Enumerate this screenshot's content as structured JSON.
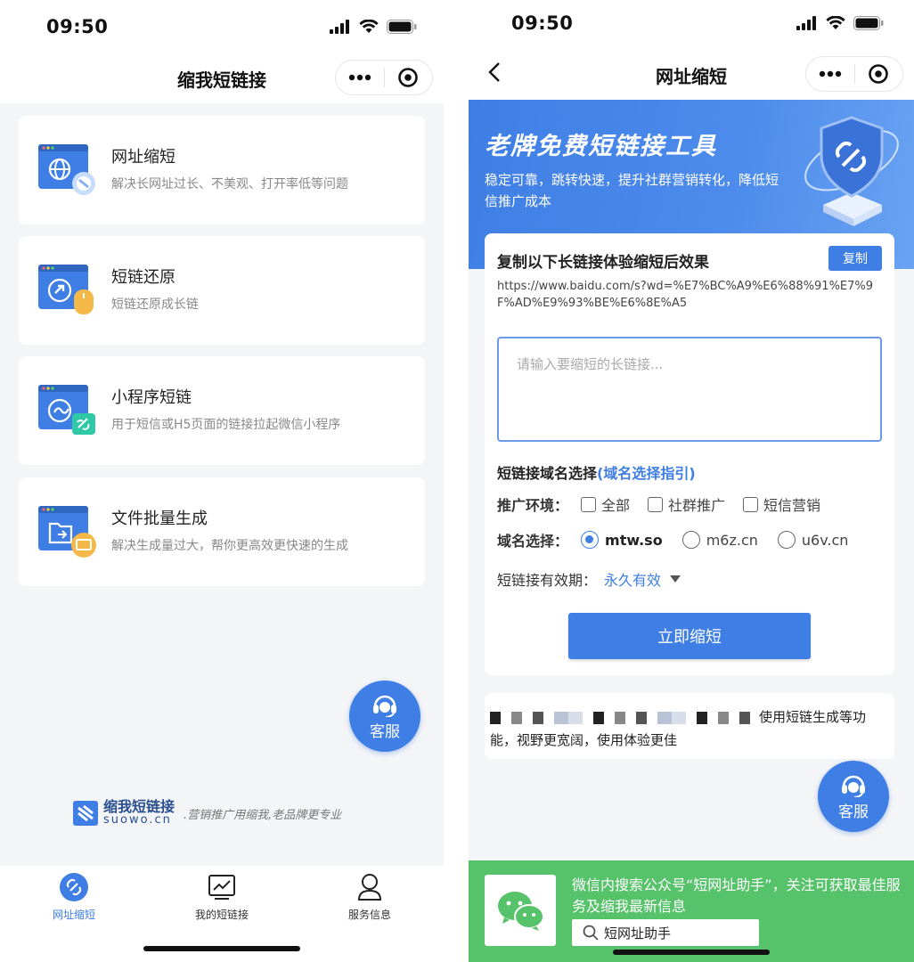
{
  "left": {
    "status_time": "09:50",
    "nav_title": "缩我短链接",
    "features": [
      {
        "title": "网址缩短",
        "desc": "解决长网址过长、不美观、打开率低等问题"
      },
      {
        "title": "短链还原",
        "desc": "短链还原成长链"
      },
      {
        "title": "小程序短链",
        "desc": "用于短信或H5页面的链接拉起微信小程序"
      },
      {
        "title": "文件批量生成",
        "desc": "解决生成量过大，帮你更高效更快速的生成"
      }
    ],
    "service_label": "客服",
    "brand_name": "缩我短链接",
    "brand_domain": "suowo.cn",
    "brand_slogan": ".营销推广用缩我,老品牌更专业",
    "tabs": [
      {
        "label": "网址缩短",
        "icon": "link-icon"
      },
      {
        "label": "我的短链接",
        "icon": "chart-icon"
      },
      {
        "label": "服务信息",
        "icon": "user-icon"
      }
    ]
  },
  "right": {
    "status_time": "09:50",
    "nav_title": "网址缩短",
    "hero_title": "老牌免费短链接工具",
    "hero_sub": "稳定可靠，跳转快速，提升社群营销转化，降低短信推广成本",
    "copy_title": "复制以下长链接体验缩短后效果",
    "copy_button": "复制",
    "sample_url": "https://www.baidu.com/s?wd=%E7%BC%A9%E6%88%91%E7%9F%AD%E9%93%BE%E6%8E%A5",
    "input_placeholder": "请输入要缩短的长链接...",
    "domain_section": "短链接域名选择",
    "domain_guide": "(域名选择指引)",
    "env_label": "推广环境：",
    "env_options": [
      "全部",
      "社群推广",
      "短信营销"
    ],
    "domain_label": "域名选择：",
    "domain_options": [
      "mtw.so",
      "m6z.cn",
      "u6v.cn"
    ],
    "domain_selected": "mtw.so",
    "validity_label": "短链接有效期：",
    "validity_value": "永久有效",
    "submit_label": "立即缩短",
    "notice_text": "使用短链生成等功能，视野更宽阔，使用体验更佳",
    "service_label": "客服",
    "banner_text": "微信内搜索公众号“短网址助手”，关注可获取最佳服务及缩我最新信息",
    "banner_search": "短网址助手"
  },
  "colors": {
    "accent": "#3f7ee4",
    "wechat": "#56c26a",
    "background": "#f4f5f7"
  }
}
